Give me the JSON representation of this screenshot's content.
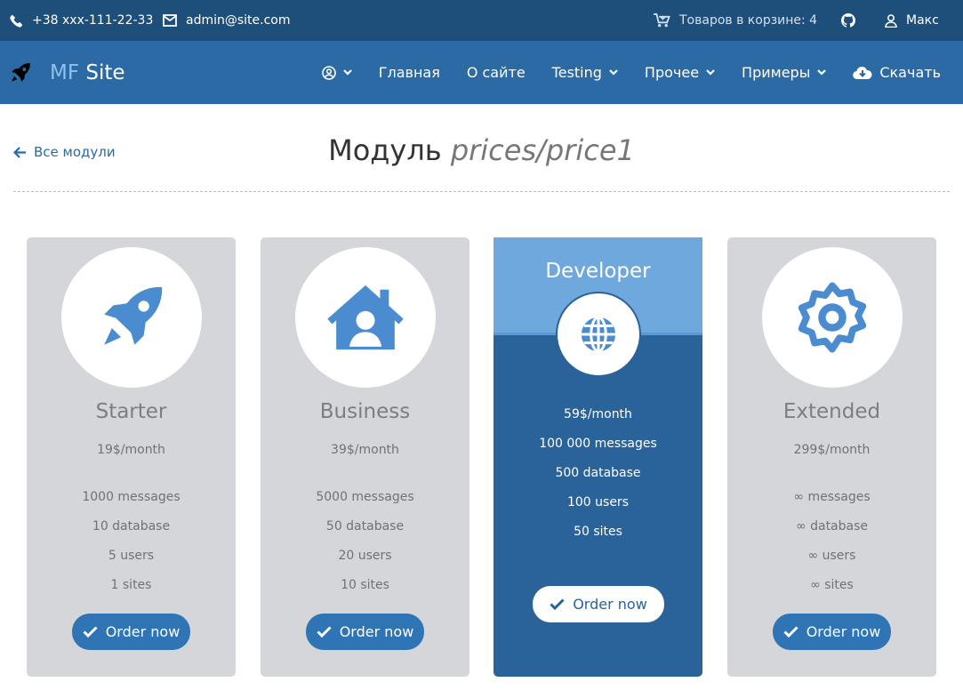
{
  "topbar": {
    "phone": "+38 xxx-111-22-33",
    "email": "admin@site.com",
    "cart_text": "Товаров в корзине: 4",
    "user": "Макс"
  },
  "brand": {
    "mf": "MF",
    "site": "Site"
  },
  "nav": {
    "home": "Главная",
    "about": "О сайте",
    "testing": "Testing",
    "other": "Прочее",
    "examples": "Примеры",
    "download": "Скачать"
  },
  "page": {
    "back_link": "Все модули",
    "title_prefix": "Модуль",
    "title_module": "prices/price1"
  },
  "plans": [
    {
      "name": "Starter",
      "price": "19$/month",
      "features": [
        "1000 messages",
        "10 database",
        "5 users",
        "1 sites"
      ],
      "button": "Order now",
      "icon": "rocket-icon"
    },
    {
      "name": "Business",
      "price": "39$/month",
      "features": [
        "5000 messages",
        "50 database",
        "20 users",
        "10 sites"
      ],
      "button": "Order now",
      "icon": "home-user-icon"
    },
    {
      "name": "Developer",
      "price": "59$/month",
      "features": [
        "100 000 messages",
        "500 database",
        "100 users",
        "50 sites"
      ],
      "button": "Order now",
      "icon": "globe-icon"
    },
    {
      "name": "Extended",
      "price": "299$/month",
      "features": [
        "∞ messages",
        "∞ database",
        "∞ users",
        "∞ sites"
      ],
      "button": "Order now",
      "icon": "gear-icon"
    }
  ],
  "colors": {
    "topbar": "#1e4f7a",
    "navbar": "#2b6aa4",
    "accent": "#2f74b5",
    "featured": "#2a639a",
    "featured_head": "#6fa8dc",
    "card": "#d4d6d9"
  }
}
